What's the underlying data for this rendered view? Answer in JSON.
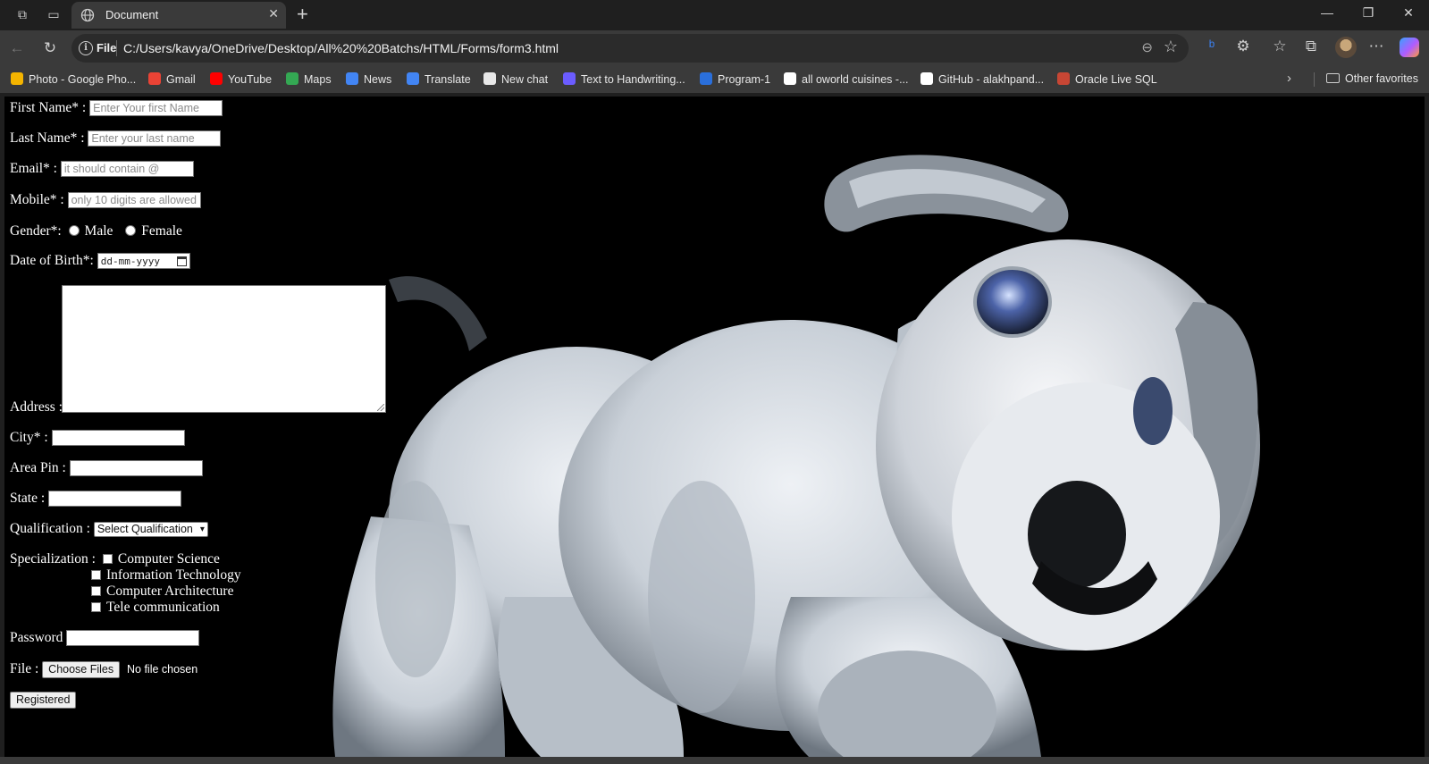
{
  "browser": {
    "tab_title": "Document",
    "scheme_label": "File",
    "url": "C:/Users/kavya/OneDrive/Desktop/All%20%20Batchs/HTML/Forms/form3.html"
  },
  "bookmarks": [
    {
      "label": "Photo - Google Pho...",
      "color": "#f4b400"
    },
    {
      "label": "Gmail",
      "color": "#ea4335"
    },
    {
      "label": "YouTube",
      "color": "#ff0000"
    },
    {
      "label": "Maps",
      "color": "#34a853"
    },
    {
      "label": "News",
      "color": "#4285f4"
    },
    {
      "label": "Translate",
      "color": "#4285f4"
    },
    {
      "label": "New chat",
      "color": "#e8e8e8"
    },
    {
      "label": "Text to Handwriting...",
      "color": "#6b5cff"
    },
    {
      "label": "Program-1",
      "color": "#2a6fdb"
    },
    {
      "label": "all oworld cuisines -...",
      "color": "#ffffff"
    },
    {
      "label": "GitHub - alakhpand...",
      "color": "#ffffff"
    },
    {
      "label": "Oracle Live SQL",
      "color": "#c74634"
    }
  ],
  "other_favorites": "Other favorites",
  "form": {
    "first_name_label": "First Name* :",
    "first_name_placeholder": "Enter Your first Name",
    "last_name_label": "Last Name* :",
    "last_name_placeholder": "Enter your last name",
    "email_label": "Email* :",
    "email_placeholder": "it should contain @",
    "mobile_label": "Mobile* :",
    "mobile_placeholder": "only 10 digits are allowed",
    "gender_label": "Gender*:",
    "gender_options": [
      "Male",
      "Female"
    ],
    "dob_label": "Date of Birth*:",
    "dob_placeholder": "dd-mm-yyyy",
    "address_label": "Address :",
    "city_label": "City* :",
    "pin_label": "Area Pin :",
    "state_label": "State :",
    "qualification_label": "Qualification :",
    "qualification_selected": "Select Qualification",
    "specialization_label": "Specialization :",
    "specializations": [
      "Computer Science",
      "Information Technology",
      "Computer Architecture",
      "Tele communication"
    ],
    "password_label": "Password",
    "file_label": "File :",
    "file_button": "Choose Files",
    "file_status": "No file chosen",
    "submit_label": "Registered"
  }
}
